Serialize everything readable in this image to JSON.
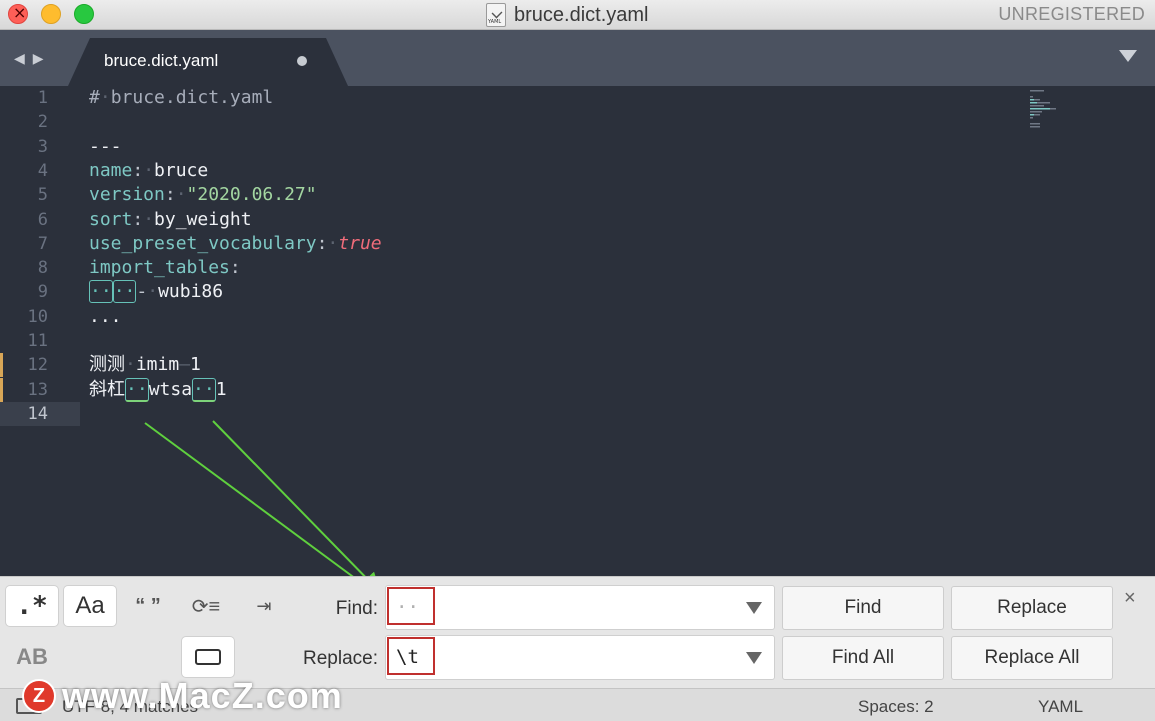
{
  "window": {
    "title": "bruce.dict.yaml",
    "file_icon_label": "YAML",
    "registration": "UNREGISTERED"
  },
  "tabs": [
    {
      "label": "bruce.dict.yaml",
      "modified": true
    }
  ],
  "editor": {
    "lines": [
      {
        "n": "1"
      },
      {
        "n": "2"
      },
      {
        "n": "3"
      },
      {
        "n": "4"
      },
      {
        "n": "5"
      },
      {
        "n": "6"
      },
      {
        "n": "7"
      },
      {
        "n": "8"
      },
      {
        "n": "9"
      },
      {
        "n": "10"
      },
      {
        "n": "11"
      },
      {
        "n": "12"
      },
      {
        "n": "13"
      },
      {
        "n": "14"
      }
    ],
    "code": {
      "l1": "bruce.dict.yaml",
      "l1_hash": "#",
      "l3": "---",
      "name_key": "name",
      "name_val": "bruce",
      "version_key": "version",
      "version_val": "\"2020.06.27\"",
      "sort_key": "sort",
      "sort_val": "by_weight",
      "vocab_key": "use_preset_vocabulary",
      "vocab_val": "true",
      "import_key": "import_tables",
      "import_val": "wubi86",
      "l10": "...",
      "l12_a": "测测",
      "l12_b": "imim",
      "l12_c": "1",
      "l13_a": "斜杠",
      "l13_b": "wtsa",
      "l13_c": "1"
    },
    "active_line": 14,
    "colors": {
      "background": "#2b303b",
      "key": "#7ec8c4",
      "string": "#a3d6a1",
      "boolean": "#ef6c7a",
      "match_highlight": "#66c2b8"
    }
  },
  "find_panel": {
    "options": {
      "regex": ".*",
      "case": "Aa",
      "whole_word": "“ ”",
      "wrap": "⟳≡",
      "in_selection": "⇥",
      "preserve_case": "AB"
    },
    "find_label": "Find:",
    "find_value": "··",
    "replace_label": "Replace:",
    "replace_value": "\\t",
    "buttons": {
      "find": "Find",
      "replace": "Replace",
      "find_all": "Find All",
      "replace_all": "Replace All"
    },
    "close": "×"
  },
  "status_bar": {
    "info": "UTF-8, 4 matches",
    "spaces": "Spaces: 2",
    "syntax": "YAML"
  },
  "watermark": {
    "logo": "Z",
    "text": "www.MacZ.com"
  }
}
